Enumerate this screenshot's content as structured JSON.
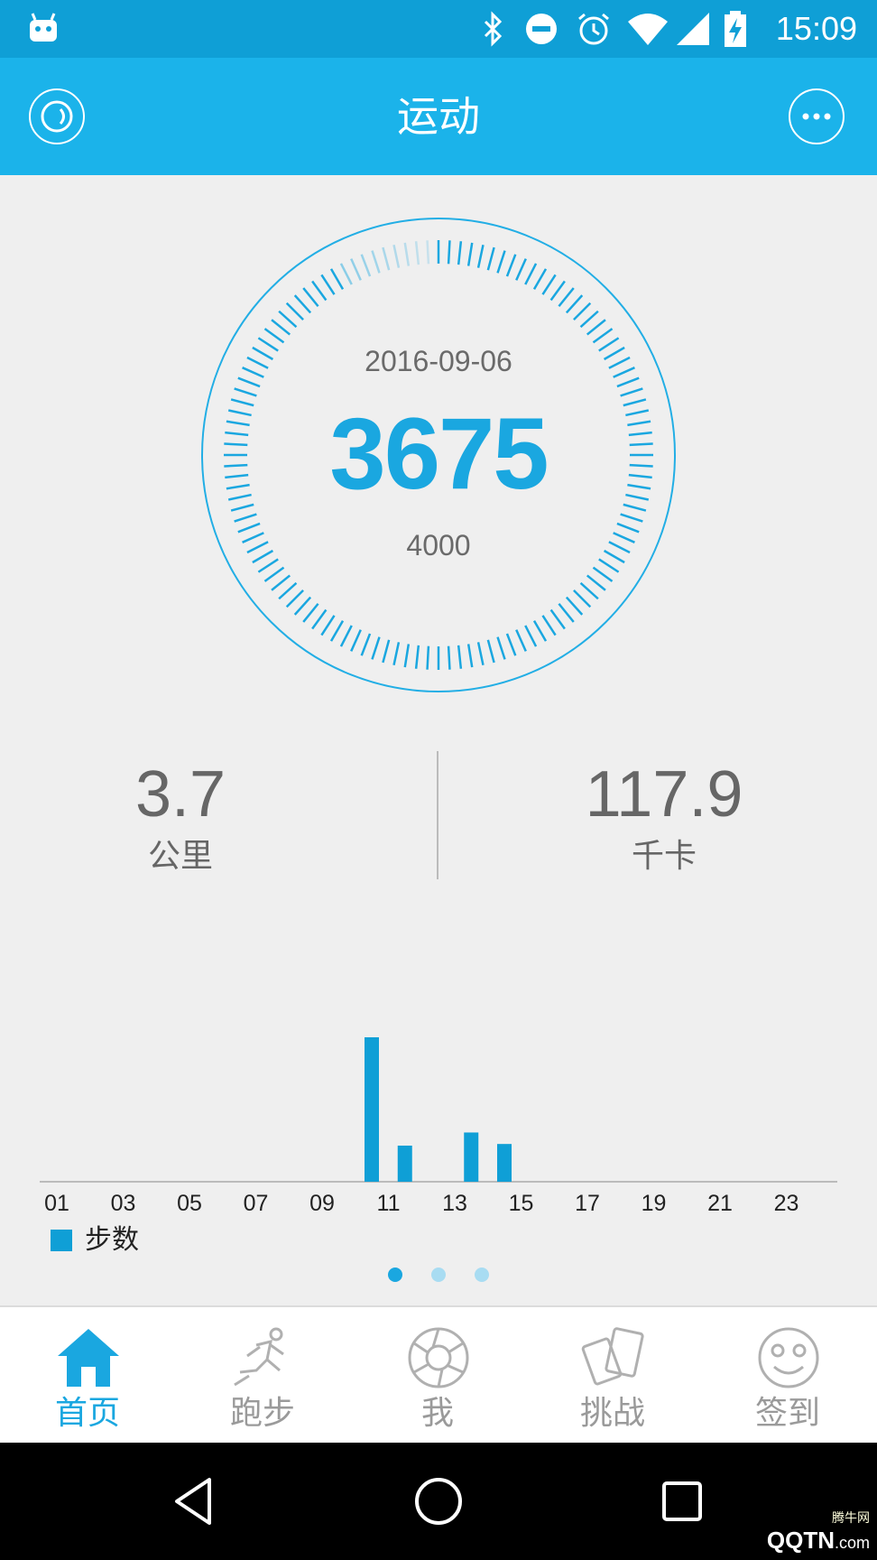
{
  "status_bar": {
    "time": "15:09",
    "icons": [
      "android-robot-icon",
      "bluetooth-icon",
      "do-not-disturb-icon",
      "alarm-icon",
      "wifi-icon",
      "signal-icon",
      "battery-charging-icon"
    ]
  },
  "app_bar": {
    "title": "运动",
    "left_icon": "device-ring-icon",
    "right_icon": "more-icon"
  },
  "dial": {
    "date": "2016-09-06",
    "steps": "3675",
    "goal": "4000",
    "progress": 0.91875,
    "accent": "#1aa7e0"
  },
  "stats": {
    "distance": {
      "value": "3.7",
      "unit": "公里"
    },
    "calories": {
      "value": "117.9",
      "unit": "千卡"
    }
  },
  "chart_data": {
    "type": "bar",
    "x_tick_labels": [
      "01",
      "03",
      "05",
      "07",
      "09",
      "11",
      "13",
      "15",
      "17",
      "19",
      "21",
      "23"
    ],
    "hours": [
      "00",
      "01",
      "02",
      "03",
      "04",
      "05",
      "06",
      "07",
      "08",
      "09",
      "10",
      "11",
      "12",
      "13",
      "14",
      "15",
      "16",
      "17",
      "18",
      "19",
      "20",
      "21",
      "22",
      "23"
    ],
    "series": [
      {
        "name": "步数",
        "color": "#0f9fd6",
        "values": [
          0,
          0,
          0,
          0,
          0,
          0,
          0,
          0,
          0,
          1760,
          440,
          0,
          600,
          460,
          0,
          0,
          0,
          0,
          0,
          0,
          0,
          0,
          0,
          0
        ]
      }
    ]
  },
  "pager": {
    "count": 3,
    "active": 0
  },
  "tabs": [
    {
      "label": "首页",
      "icon": "home-icon",
      "active": true
    },
    {
      "label": "跑步",
      "icon": "runner-icon",
      "active": false
    },
    {
      "label": "我",
      "icon": "aperture-icon",
      "active": false
    },
    {
      "label": "挑战",
      "icon": "cards-icon",
      "active": false
    },
    {
      "label": "签到",
      "icon": "smiley-icon",
      "active": false
    }
  ],
  "nav_bar": {
    "icons": [
      "back-icon",
      "home-circle-icon",
      "recents-icon"
    ]
  },
  "watermark": {
    "brand": "QQTN",
    "suffix": ".com",
    "small": "腾牛网"
  }
}
